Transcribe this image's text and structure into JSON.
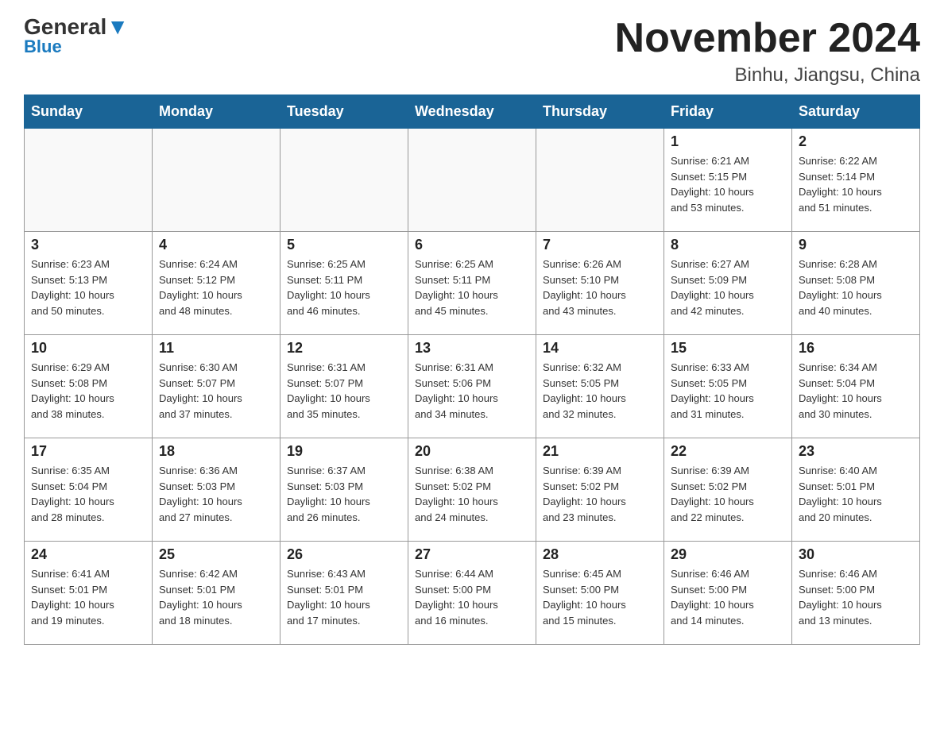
{
  "header": {
    "logo_general": "General",
    "logo_blue": "Blue",
    "month_title": "November 2024",
    "location": "Binhu, Jiangsu, China"
  },
  "days_of_week": [
    "Sunday",
    "Monday",
    "Tuesday",
    "Wednesday",
    "Thursday",
    "Friday",
    "Saturday"
  ],
  "weeks": [
    {
      "days": [
        {
          "num": "",
          "info": ""
        },
        {
          "num": "",
          "info": ""
        },
        {
          "num": "",
          "info": ""
        },
        {
          "num": "",
          "info": ""
        },
        {
          "num": "",
          "info": ""
        },
        {
          "num": "1",
          "info": "Sunrise: 6:21 AM\nSunset: 5:15 PM\nDaylight: 10 hours\nand 53 minutes."
        },
        {
          "num": "2",
          "info": "Sunrise: 6:22 AM\nSunset: 5:14 PM\nDaylight: 10 hours\nand 51 minutes."
        }
      ]
    },
    {
      "days": [
        {
          "num": "3",
          "info": "Sunrise: 6:23 AM\nSunset: 5:13 PM\nDaylight: 10 hours\nand 50 minutes."
        },
        {
          "num": "4",
          "info": "Sunrise: 6:24 AM\nSunset: 5:12 PM\nDaylight: 10 hours\nand 48 minutes."
        },
        {
          "num": "5",
          "info": "Sunrise: 6:25 AM\nSunset: 5:11 PM\nDaylight: 10 hours\nand 46 minutes."
        },
        {
          "num": "6",
          "info": "Sunrise: 6:25 AM\nSunset: 5:11 PM\nDaylight: 10 hours\nand 45 minutes."
        },
        {
          "num": "7",
          "info": "Sunrise: 6:26 AM\nSunset: 5:10 PM\nDaylight: 10 hours\nand 43 minutes."
        },
        {
          "num": "8",
          "info": "Sunrise: 6:27 AM\nSunset: 5:09 PM\nDaylight: 10 hours\nand 42 minutes."
        },
        {
          "num": "9",
          "info": "Sunrise: 6:28 AM\nSunset: 5:08 PM\nDaylight: 10 hours\nand 40 minutes."
        }
      ]
    },
    {
      "days": [
        {
          "num": "10",
          "info": "Sunrise: 6:29 AM\nSunset: 5:08 PM\nDaylight: 10 hours\nand 38 minutes."
        },
        {
          "num": "11",
          "info": "Sunrise: 6:30 AM\nSunset: 5:07 PM\nDaylight: 10 hours\nand 37 minutes."
        },
        {
          "num": "12",
          "info": "Sunrise: 6:31 AM\nSunset: 5:07 PM\nDaylight: 10 hours\nand 35 minutes."
        },
        {
          "num": "13",
          "info": "Sunrise: 6:31 AM\nSunset: 5:06 PM\nDaylight: 10 hours\nand 34 minutes."
        },
        {
          "num": "14",
          "info": "Sunrise: 6:32 AM\nSunset: 5:05 PM\nDaylight: 10 hours\nand 32 minutes."
        },
        {
          "num": "15",
          "info": "Sunrise: 6:33 AM\nSunset: 5:05 PM\nDaylight: 10 hours\nand 31 minutes."
        },
        {
          "num": "16",
          "info": "Sunrise: 6:34 AM\nSunset: 5:04 PM\nDaylight: 10 hours\nand 30 minutes."
        }
      ]
    },
    {
      "days": [
        {
          "num": "17",
          "info": "Sunrise: 6:35 AM\nSunset: 5:04 PM\nDaylight: 10 hours\nand 28 minutes."
        },
        {
          "num": "18",
          "info": "Sunrise: 6:36 AM\nSunset: 5:03 PM\nDaylight: 10 hours\nand 27 minutes."
        },
        {
          "num": "19",
          "info": "Sunrise: 6:37 AM\nSunset: 5:03 PM\nDaylight: 10 hours\nand 26 minutes."
        },
        {
          "num": "20",
          "info": "Sunrise: 6:38 AM\nSunset: 5:02 PM\nDaylight: 10 hours\nand 24 minutes."
        },
        {
          "num": "21",
          "info": "Sunrise: 6:39 AM\nSunset: 5:02 PM\nDaylight: 10 hours\nand 23 minutes."
        },
        {
          "num": "22",
          "info": "Sunrise: 6:39 AM\nSunset: 5:02 PM\nDaylight: 10 hours\nand 22 minutes."
        },
        {
          "num": "23",
          "info": "Sunrise: 6:40 AM\nSunset: 5:01 PM\nDaylight: 10 hours\nand 20 minutes."
        }
      ]
    },
    {
      "days": [
        {
          "num": "24",
          "info": "Sunrise: 6:41 AM\nSunset: 5:01 PM\nDaylight: 10 hours\nand 19 minutes."
        },
        {
          "num": "25",
          "info": "Sunrise: 6:42 AM\nSunset: 5:01 PM\nDaylight: 10 hours\nand 18 minutes."
        },
        {
          "num": "26",
          "info": "Sunrise: 6:43 AM\nSunset: 5:01 PM\nDaylight: 10 hours\nand 17 minutes."
        },
        {
          "num": "27",
          "info": "Sunrise: 6:44 AM\nSunset: 5:00 PM\nDaylight: 10 hours\nand 16 minutes."
        },
        {
          "num": "28",
          "info": "Sunrise: 6:45 AM\nSunset: 5:00 PM\nDaylight: 10 hours\nand 15 minutes."
        },
        {
          "num": "29",
          "info": "Sunrise: 6:46 AM\nSunset: 5:00 PM\nDaylight: 10 hours\nand 14 minutes."
        },
        {
          "num": "30",
          "info": "Sunrise: 6:46 AM\nSunset: 5:00 PM\nDaylight: 10 hours\nand 13 minutes."
        }
      ]
    }
  ]
}
